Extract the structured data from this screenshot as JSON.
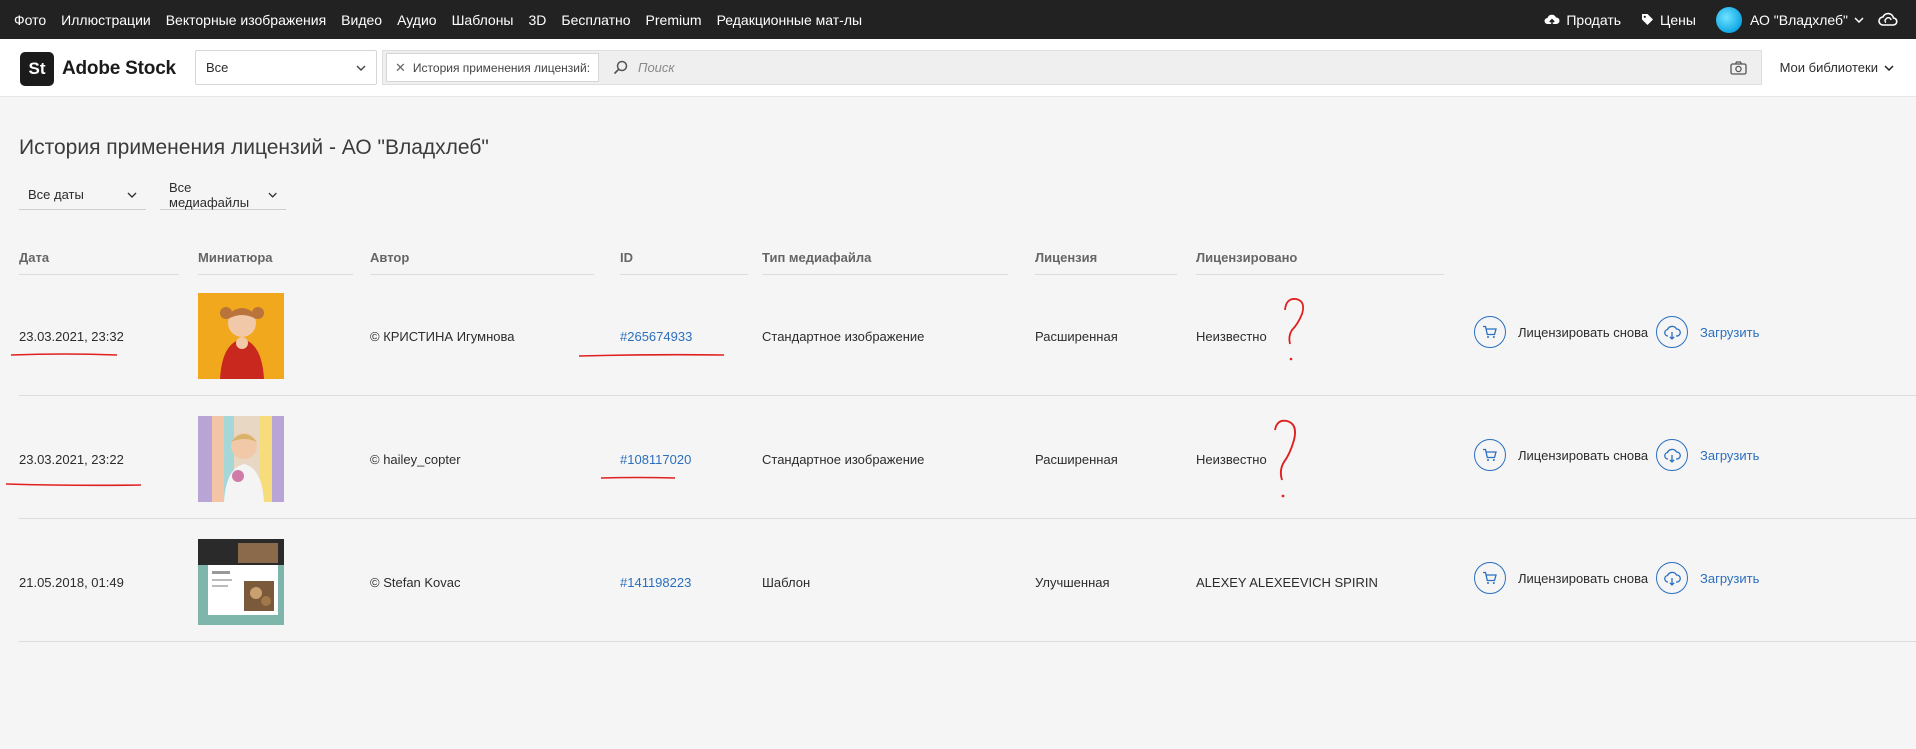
{
  "topnav": {
    "links": [
      "Фото",
      "Иллюстрации",
      "Векторные изображения",
      "Видео",
      "Аудио",
      "Шаблоны",
      "3D",
      "Бесплатно",
      "Premium",
      "Редакционные мат-лы"
    ],
    "sell": "Продать",
    "prices": "Цены",
    "account": "АО \"Владхлеб\""
  },
  "header": {
    "logo_badge": "St",
    "logo_text": "Adobe Stock",
    "scope_value": "Все",
    "chip_text": "История применения лицензий:",
    "search_placeholder": "Поиск",
    "libraries": "Мои библиотеки"
  },
  "page": {
    "title": "История применения лицензий - АО \"Владхлеб\"",
    "filter_dates": "Все даты",
    "filter_media": "Все медиафайлы"
  },
  "table": {
    "headers": {
      "date": "Дата",
      "thumb": "Миниатюра",
      "author": "Автор",
      "id": "ID",
      "type": "Тип медиафайла",
      "license": "Лицензия",
      "licensed_by": "Лицензировано"
    },
    "rows": [
      {
        "date": "23.03.2021, 23:32",
        "author": "© КРИСТИНА Игумнова",
        "id": "#265674933",
        "type": "Стандартное изображение",
        "license": "Расширенная",
        "licensed_by": "Неизвестно",
        "relicense": "Лицензировать снова",
        "download": "Загрузить"
      },
      {
        "date": "23.03.2021, 23:22",
        "author": "© hailey_copter",
        "id": "#108117020",
        "type": "Стандартное изображение",
        "license": "Расширенная",
        "licensed_by": "Неизвестно",
        "relicense": "Лицензировать снова",
        "download": "Загрузить"
      },
      {
        "date": "21.05.2018, 01:49",
        "author": "© Stefan Kovac",
        "id": "#141198223",
        "type": "Шаблон",
        "license": "Улучшенная",
        "licensed_by": "ALEXEY ALEXEEVICH SPIRIN",
        "relicense": "Лицензировать снова",
        "download": "Загрузить"
      }
    ]
  },
  "colors": {
    "topnav_bg": "#222222",
    "link": "#2b6fbf",
    "annotation": "#e02020"
  },
  "icons": [
    "cloud-upload-icon",
    "tag-icon",
    "chevron-down-icon",
    "creative-cloud-icon",
    "search-icon",
    "camera-icon",
    "close-icon",
    "cart-icon",
    "download-cloud-icon"
  ]
}
